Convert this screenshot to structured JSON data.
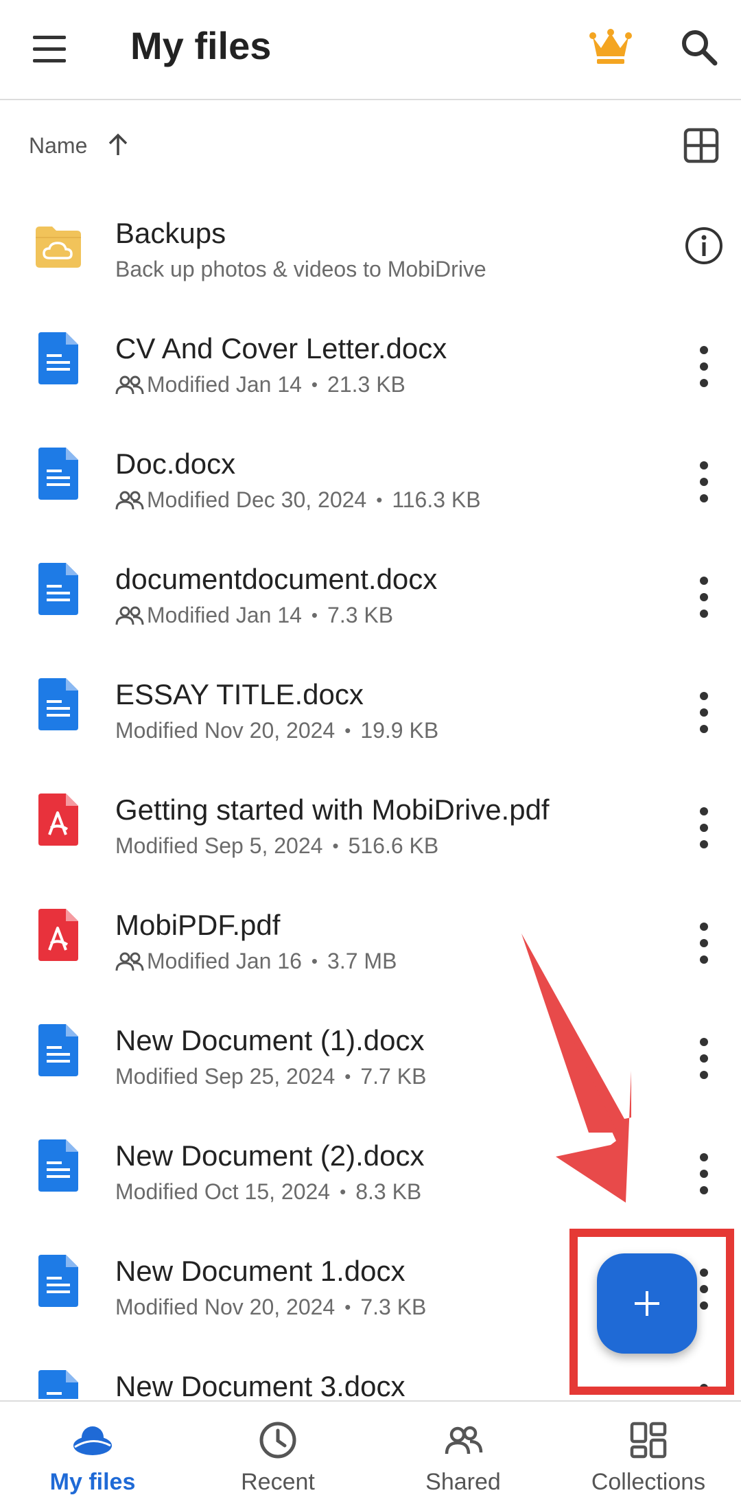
{
  "appbar": {
    "title": "My files",
    "menu_icon": "menu-icon",
    "premium_icon": "crown-icon",
    "search_icon": "search-icon"
  },
  "sort": {
    "label": "Name",
    "direction_icon": "arrow-up-icon",
    "view_toggle_icon": "grid-view-icon"
  },
  "files": [
    {
      "name": "Backups",
      "subtitle": "Back up photos & videos to MobiDrive",
      "type": "folder"
    },
    {
      "name": "CV And Cover Letter.docx",
      "modified": "Modified Jan 14",
      "size": "21.3 KB",
      "type": "docx",
      "shared": true
    },
    {
      "name": "Doc.docx",
      "modified": "Modified Dec 30, 2024",
      "size": "116.3 KB",
      "type": "docx",
      "shared": true
    },
    {
      "name": "documentdocument.docx",
      "modified": "Modified Jan 14",
      "size": "7.3 KB",
      "type": "docx",
      "shared": true
    },
    {
      "name": "ESSAY TITLE.docx",
      "modified": "Modified Nov 20, 2024",
      "size": "19.9 KB",
      "type": "docx",
      "shared": false
    },
    {
      "name": "Getting started with MobiDrive.pdf",
      "modified": "Modified Sep 5, 2024",
      "size": "516.6 KB",
      "type": "pdf",
      "shared": false
    },
    {
      "name": "MobiPDF.pdf",
      "modified": "Modified Jan 16",
      "size": "3.7 MB",
      "type": "pdf",
      "shared": true
    },
    {
      "name": "New Document (1).docx",
      "modified": "Modified Sep 25, 2024",
      "size": "7.7 KB",
      "type": "docx",
      "shared": false
    },
    {
      "name": "New Document (2).docx",
      "modified": "Modified Oct 15, 2024",
      "size": "8.3 KB",
      "type": "docx",
      "shared": false
    },
    {
      "name": "New Document 1.docx",
      "modified": "Modified Nov 20, 2024",
      "size": "7.3 KB",
      "type": "docx",
      "shared": false
    },
    {
      "name": "New Document 3.docx",
      "type": "docx"
    }
  ],
  "nav": {
    "items": [
      {
        "label": "My files",
        "icon": "cloud-icon",
        "active": true
      },
      {
        "label": "Recent",
        "icon": "clock-icon",
        "active": false
      },
      {
        "label": "Shared",
        "icon": "people-icon",
        "active": false
      },
      {
        "label": "Collections",
        "icon": "collections-icon",
        "active": false
      }
    ]
  },
  "fab": {
    "icon": "plus-icon"
  },
  "colors": {
    "accent": "#1f6ad6",
    "doc_blue": "#1e7be6",
    "pdf_red": "#e8323c",
    "folder_yellow": "#f1c35a",
    "crown_gold": "#f4a521",
    "annotation_red": "#e53935"
  }
}
